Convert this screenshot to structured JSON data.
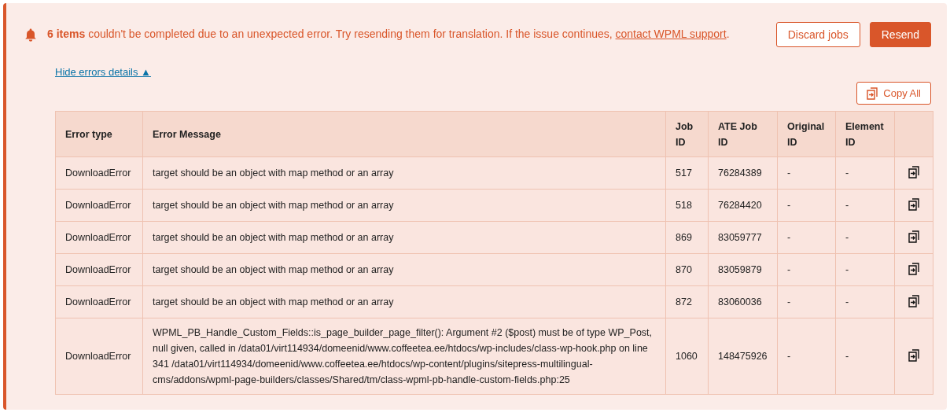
{
  "notice": {
    "message": "**6 items** couldn't be completed due to an unexpected error. Try resending them for translation. If the issue continues, ",
    "link": "contact WPML support",
    "message_end": ".",
    "toggle": "Hide errors details ▲"
  },
  "buttons": [
    {
      "label": "Discard jobs",
      "kind": "outline"
    },
    {
      "label": "Resend",
      "kind": "primary"
    }
  ],
  "copy_all": "Copy All",
  "table": {
    "columns": [
      "Error type",
      "Error Message",
      "Job ID",
      "ATE Job ID",
      "Original ID",
      "Element ID"
    ],
    "rows": [
      {
        "cells": [
          "DownloadError",
          "target should be an object with map method or an array",
          "517",
          "76284389",
          "-",
          "-"
        ]
      },
      {
        "cells": [
          "DownloadError",
          "target should be an object with map method or an array",
          "518",
          "76284420",
          "-",
          "-"
        ]
      },
      {
        "cells": [
          "DownloadError",
          "target should be an object with map method or an array",
          "869",
          "83059777",
          "-",
          "-"
        ]
      },
      {
        "cells": [
          "DownloadError",
          "target should be an object with map method or an array",
          "870",
          "83059879",
          "-",
          "-"
        ]
      },
      {
        "cells": [
          "DownloadError",
          "target should be an object with map method or an array",
          "872",
          "83060036",
          "-",
          "-"
        ]
      },
      {
        "cells": [
          "DownloadError",
          "WPML_PB_Handle_Custom_Fields::is_page_builder_page_filter(): Argument #2 ($post) must be of type WP_Post, null given, called in /data01/virt114934/domeenid/www.coffeetea.ee/htdocs/wp-includes/class-wp-hook.php on line 341 /data01/virt114934/domeenid/www.coffeetea.ee/htdocs/wp-content/plugins/sitepress-multilingual-cms/addons/wpml-page-builders/classes/Shared/tm/class-wpml-pb-handle-custom-fields.php:25",
          "1060",
          "148475926",
          "-",
          "-"
        ]
      }
    ]
  }
}
